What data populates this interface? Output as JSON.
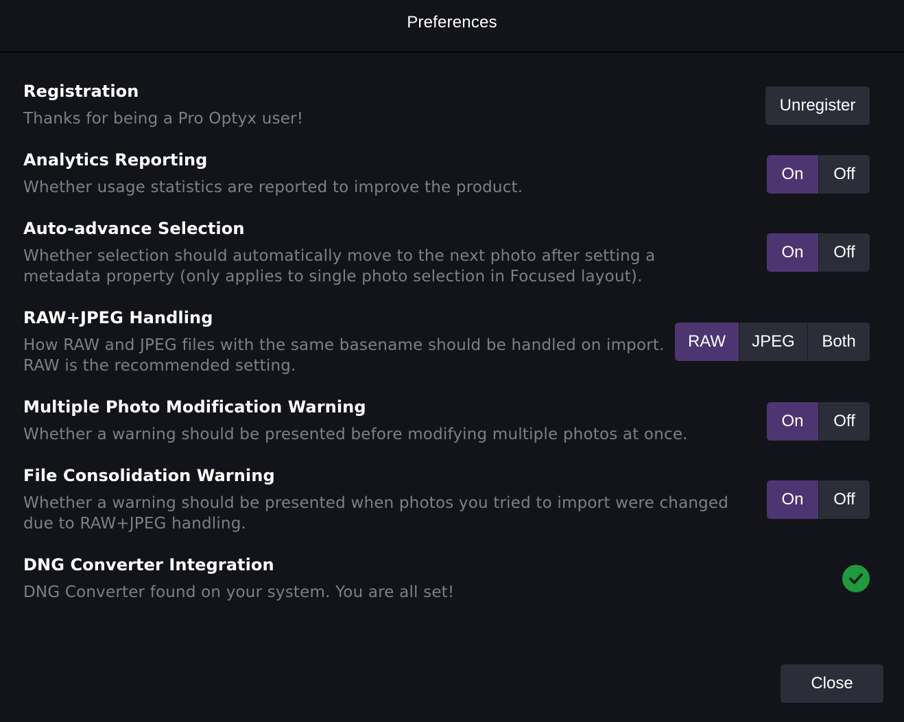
{
  "window": {
    "title": "Preferences"
  },
  "settings": [
    {
      "title": "Registration",
      "description": "Thanks for being a Pro Optyx user!",
      "control": {
        "type": "button",
        "label": "Unregister"
      }
    },
    {
      "title": "Analytics Reporting",
      "description": "Whether usage statistics are reported to improve the product.",
      "control": {
        "type": "segmented",
        "options": [
          "On",
          "Off"
        ],
        "selected": "On"
      }
    },
    {
      "title": "Auto-advance Selection",
      "description": "Whether selection should automatically move to the next photo after setting a metadata property (only applies to single photo selection in Focused layout).",
      "control": {
        "type": "segmented",
        "options": [
          "On",
          "Off"
        ],
        "selected": "On"
      }
    },
    {
      "title": "RAW+JPEG Handling",
      "description": "How RAW and JPEG files with the same basename should be handled on import. RAW is the recommended setting.",
      "control": {
        "type": "segmented",
        "options": [
          "RAW",
          "JPEG",
          "Both"
        ],
        "selected": "RAW"
      }
    },
    {
      "title": "Multiple Photo Modification Warning",
      "description": "Whether a warning should be presented before modifying multiple photos at once.",
      "control": {
        "type": "segmented",
        "options": [
          "On",
          "Off"
        ],
        "selected": "On"
      }
    },
    {
      "title": "File Consolidation Warning",
      "description": "Whether a warning should be presented when photos you tried to import were changed due to RAW+JPEG handling.",
      "control": {
        "type": "segmented",
        "options": [
          "On",
          "Off"
        ],
        "selected": "On"
      }
    },
    {
      "title": "DNG Converter Integration",
      "description": "DNG Converter found on your system. You are all set!",
      "control": {
        "type": "status",
        "icon": "checkmark-circle-icon",
        "color": "#1f9a3d"
      }
    }
  ],
  "footer": {
    "close_label": "Close"
  },
  "colors": {
    "background": "#131419",
    "button": "#2b2e38",
    "selected": "#4d3571",
    "description": "#7c7f8c",
    "success": "#1f9a3d"
  }
}
